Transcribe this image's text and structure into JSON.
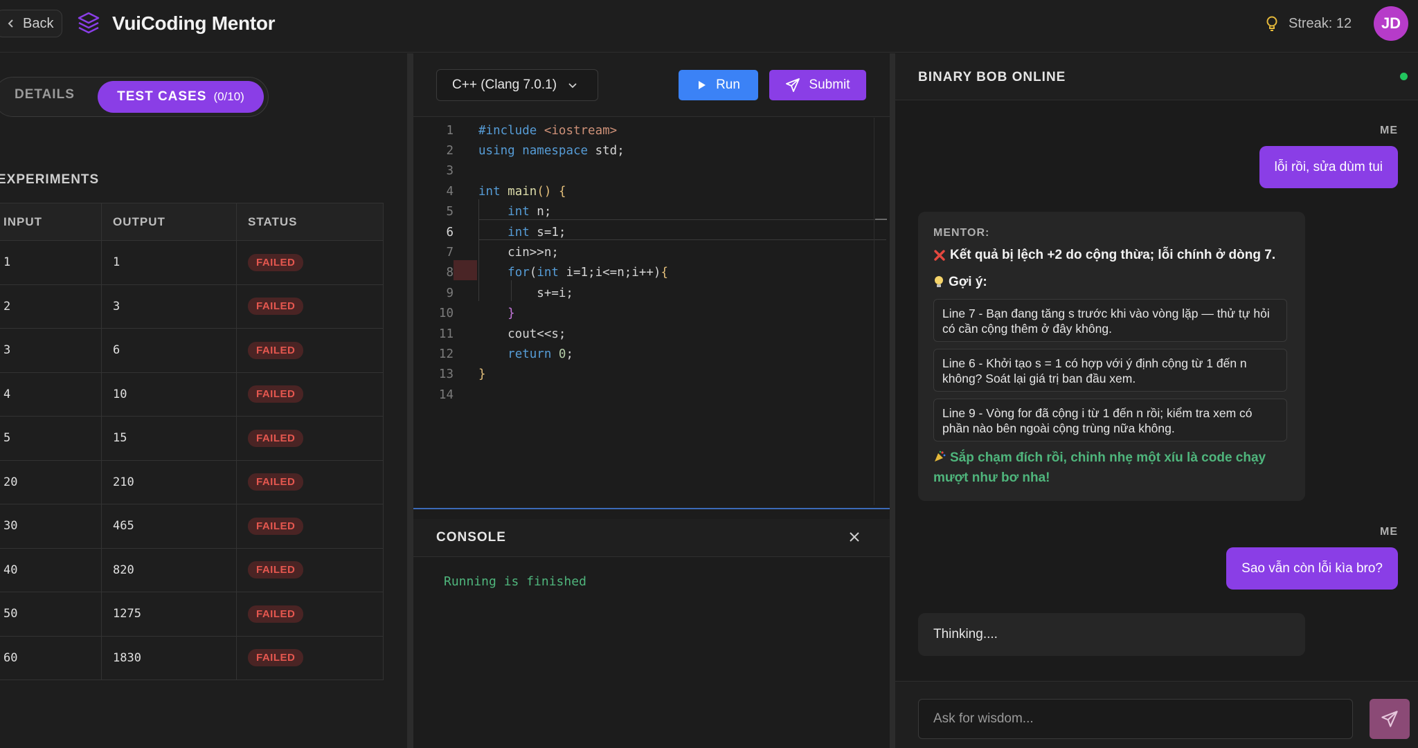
{
  "header": {
    "back_label": "Back",
    "app_title": "VuiCoding Mentor",
    "streak_label": "Streak: 12",
    "avatar_initials": "JD",
    "accent_color": "#8a3ee6"
  },
  "left": {
    "tabs": {
      "details": "DETAILS",
      "test_cases": "TEST CASES",
      "test_cases_count": "(0/10)"
    },
    "section_title": "EXPERIMENTS",
    "table": {
      "headers": [
        "INPUT",
        "OUTPUT",
        "STATUS"
      ],
      "rows": [
        {
          "input": "1",
          "output": "1",
          "status": "FAILED"
        },
        {
          "input": "2",
          "output": "3",
          "status": "FAILED"
        },
        {
          "input": "3",
          "output": "6",
          "status": "FAILED"
        },
        {
          "input": "4",
          "output": "10",
          "status": "FAILED"
        },
        {
          "input": "5",
          "output": "15",
          "status": "FAILED"
        },
        {
          "input": "20",
          "output": "210",
          "status": "FAILED"
        },
        {
          "input": "30",
          "output": "465",
          "status": "FAILED"
        },
        {
          "input": "40",
          "output": "820",
          "status": "FAILED"
        },
        {
          "input": "50",
          "output": "1275",
          "status": "FAILED"
        },
        {
          "input": "60",
          "output": "1830",
          "status": "FAILED"
        }
      ]
    }
  },
  "editor": {
    "language": "C++ (Clang 7.0.1)",
    "run_label": "Run",
    "submit_label": "Submit",
    "active_line": 6,
    "lines": [
      "#include <iostream>",
      "using namespace std;",
      "",
      "int main() {",
      "    int n;",
      "    int s=1;",
      "    cin>>n;",
      "    for(int i=1;i<=n;i++){",
      "        s+=i;",
      "    }",
      "    cout<<s;",
      "    return 0;",
      "}",
      ""
    ]
  },
  "console": {
    "title": "CONSOLE",
    "output": "Running is finished"
  },
  "chat": {
    "title": "BINARY BOB ONLINE",
    "me_label": "ME",
    "msg1": "lỗi rồi, sửa dùm tui",
    "mentor": {
      "label": "MENTOR:",
      "summary": "Kết quả bị lệch +2 do cộng thừa; lỗi chính ở dòng 7.",
      "hint_title": "Gợi ý:",
      "hints": [
        "Line 7 - Bạn đang tăng s trước khi vào vòng lặp — thử tự hỏi có cần cộng thêm ở đây không.",
        "Line 6 - Khởi tạo s = 1 có hợp với ý định cộng từ 1 đến n không? Soát lại giá trị ban đầu xem.",
        "Line 9 - Vòng for đã cộng i từ 1 đến n rồi; kiểm tra xem có phần nào bên ngoài cộng trùng nữa không."
      ],
      "cheer": "Sắp chạm đích rồi, chỉnh nhẹ một xíu là code chạy mượt như bơ nha!"
    },
    "msg2": "Sao vẫn còn lỗi kìa bro?",
    "thinking": "Thinking....",
    "input_placeholder": "Ask for wisdom..."
  }
}
